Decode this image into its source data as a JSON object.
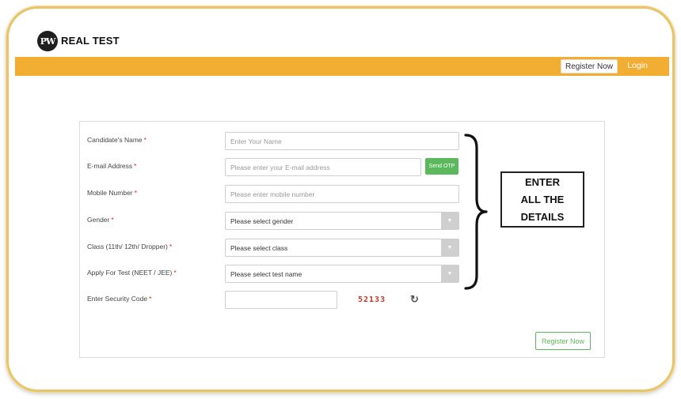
{
  "header": {
    "logo_mark": "PW",
    "logo_text": "REAL TEST"
  },
  "topbar": {
    "register_label": "Register Now",
    "login_label": "Login"
  },
  "form": {
    "name": {
      "label": "Candidate's Name",
      "placeholder": "Enter Your Name"
    },
    "email": {
      "label": "E-mail Address",
      "placeholder": "Please enter your E-mail address",
      "otp_label": "Send OTP"
    },
    "mobile": {
      "label": "Mobile Number",
      "placeholder": "Please enter mobile number"
    },
    "gender": {
      "label": "Gender",
      "selected": "Please select gender"
    },
    "class": {
      "label": "Class (11th/ 12th/ Dropper)",
      "selected": "Please select class"
    },
    "test": {
      "label": "Apply For Test (NEET / JEE)",
      "selected": "Please select test name"
    },
    "security": {
      "label": "Enter Security Code",
      "code": "52133",
      "value": ""
    },
    "required_mark": "*",
    "submit_label": "Register Now"
  },
  "callout": {
    "line1": "ENTER",
    "line2": "ALL THE",
    "line3": "DETAILS"
  },
  "colors": {
    "topbar": "#f2ad33",
    "otp_button": "#5cb85c",
    "required": "#dd2222",
    "captcha": "#c0392b"
  },
  "icons": {
    "select_arrow": "chevron-down-icon",
    "refresh": "refresh-icon"
  }
}
